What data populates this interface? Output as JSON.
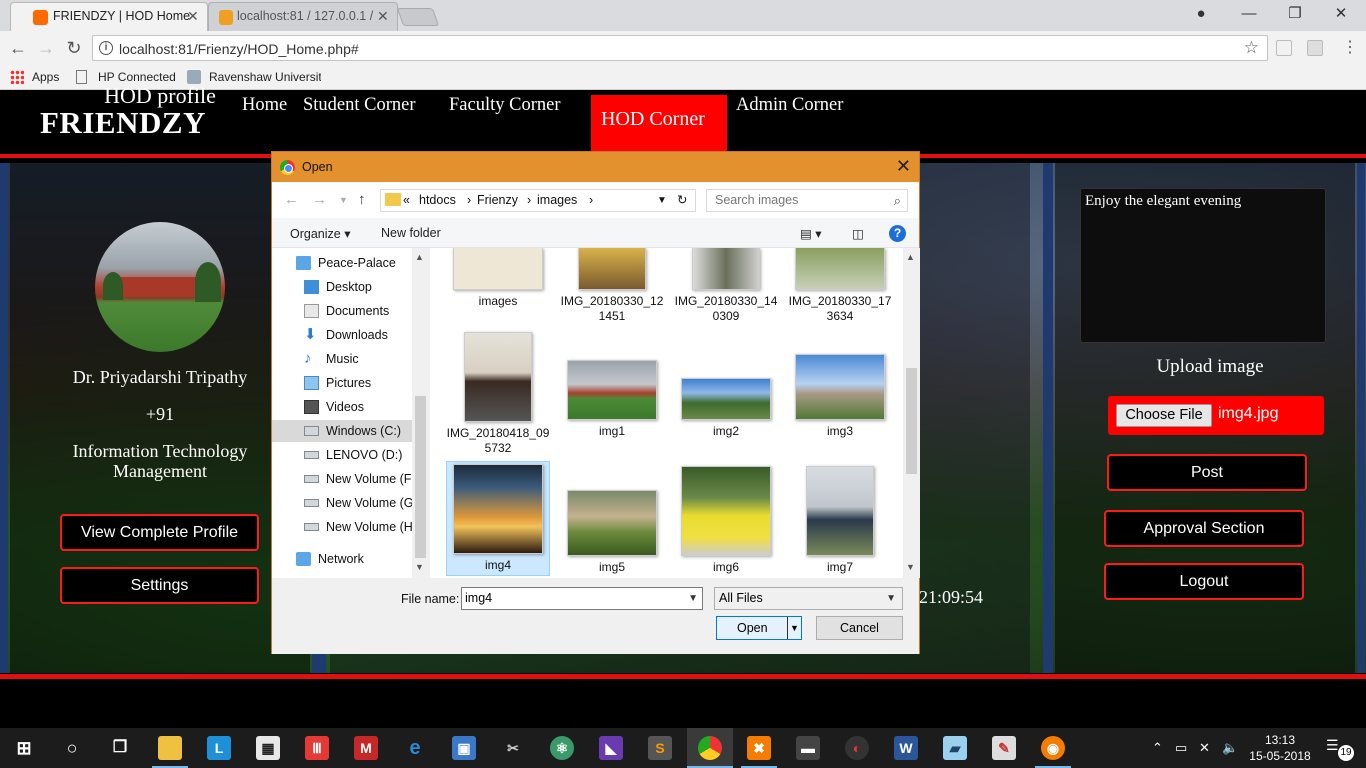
{
  "browser": {
    "tabs": [
      {
        "title": "FRIENDZY | HOD Home",
        "active": true
      },
      {
        "title": "localhost:81 / 127.0.0.1 /",
        "active": false
      }
    ],
    "url": "localhost:81/Frienzy/HOD_Home.php#",
    "bookmarks": [
      "Apps",
      "HP Connected",
      "Ravenshaw University"
    ]
  },
  "site": {
    "brand": "FRIENDZY",
    "nav": [
      "Home",
      "Student Corner",
      "Faculty Corner",
      "HOD Corner",
      "Admin Corner"
    ],
    "active_nav": "HOD Corner",
    "accent_color": "#ff0000"
  },
  "profile": {
    "title": "HOD profile",
    "name": "Dr. Priyadarshi Tripathy",
    "phone": "+91",
    "department": "Information Technology Management",
    "buttons": {
      "view_profile": "View Complete Profile",
      "settings": "Settings"
    }
  },
  "post_panel": {
    "textarea_text": "Enjoy the elegant evening",
    "upload_title": "Upload image",
    "choose_file_label": "Choose File",
    "chosen_file": "img4.jpg",
    "buttons": {
      "post": "Post",
      "approval": "Approval Section",
      "logout": "Logout"
    }
  },
  "clock_text": "21:09:54",
  "dialog": {
    "title": "Open",
    "breadcrumb": [
      "«",
      "htdocs",
      "Frienzy",
      "images"
    ],
    "search_placeholder": "Search images",
    "organize_label": "Organize",
    "new_folder_label": "New folder",
    "nav_items": [
      "Peace-Palace",
      "Desktop",
      "Documents",
      "Downloads",
      "Music",
      "Pictures",
      "Videos",
      "Windows (C:)",
      "LENOVO (D:)",
      "New Volume (F:)",
      "New Volume (G:)",
      "New Volume (H:)",
      "Network"
    ],
    "selected_nav": "Windows (C:)",
    "files": [
      {
        "name": "images"
      },
      {
        "name": "IMG_20180330_121451"
      },
      {
        "name": "IMG_20180330_140309"
      },
      {
        "name": "IMG_20180330_173634"
      },
      {
        "name": "IMG_20180418_095732"
      },
      {
        "name": "img1"
      },
      {
        "name": "img2"
      },
      {
        "name": "img3"
      },
      {
        "name": "img4"
      },
      {
        "name": "img5"
      },
      {
        "name": "img6"
      },
      {
        "name": "img7"
      }
    ],
    "selected_file": "img4",
    "file_name_label": "File name:",
    "file_name_value": "img4",
    "file_type": "All Files",
    "open_label": "Open",
    "cancel_label": "Cancel"
  },
  "taskbar": {
    "time": "13:13",
    "date": "15-05-2018",
    "notification_count": "19"
  }
}
